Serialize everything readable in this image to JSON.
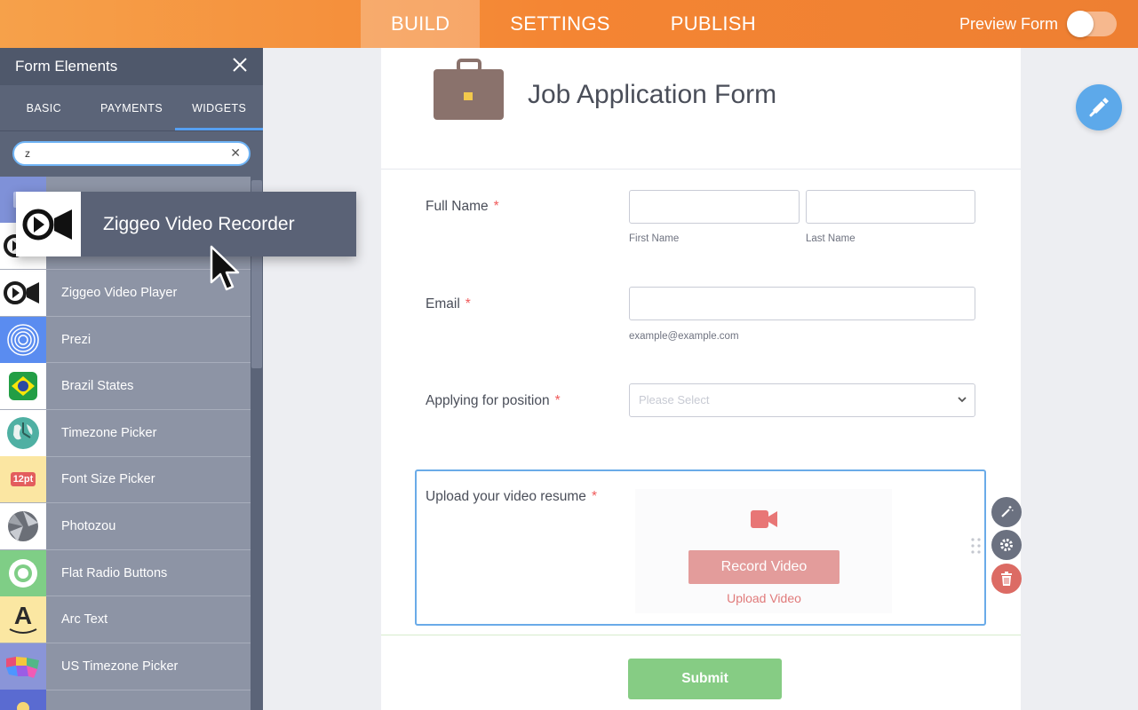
{
  "topbar": {
    "tabs": [
      {
        "label": "BUILD",
        "active": true
      },
      {
        "label": "SETTINGS",
        "active": false
      },
      {
        "label": "PUBLISH",
        "active": false
      }
    ],
    "preview_label": "Preview Form",
    "preview_on": false
  },
  "sidebar": {
    "title": "Form Elements",
    "tabs": [
      {
        "label": "BASIC",
        "active": false
      },
      {
        "label": "PAYMENTS",
        "active": false
      },
      {
        "label": "WIDGETS",
        "active": true
      }
    ],
    "search_value": "z",
    "items": [
      {
        "label": "",
        "icon": "widget-icon"
      },
      {
        "label": "",
        "icon": "ziggeo-recorder-icon"
      },
      {
        "label": "Ziggeo Video Player",
        "icon": "ziggeo-player-icon"
      },
      {
        "label": "Prezi",
        "icon": "prezi-icon"
      },
      {
        "label": "Brazil States",
        "icon": "brazil-flag-icon"
      },
      {
        "label": "Timezone Picker",
        "icon": "globe-icon"
      },
      {
        "label": "Font Size Picker",
        "icon": "font-size-icon",
        "icon_text": "12pt"
      },
      {
        "label": "Photozou",
        "icon": "photozou-icon"
      },
      {
        "label": "Flat Radio Buttons",
        "icon": "radio-button-icon"
      },
      {
        "label": "Arc Text",
        "icon": "arc-text-icon",
        "icon_text": "A"
      },
      {
        "label": "US Timezone Picker",
        "icon": "us-map-icon"
      },
      {
        "label": "",
        "icon": "widget-icon"
      }
    ]
  },
  "drag_ghost": {
    "label": "Ziggeo Video Recorder",
    "icon": "video-camera-icon"
  },
  "form": {
    "title": "Job Application Form",
    "full_name": {
      "label": "Full Name",
      "required": "*",
      "first_sub": "First Name",
      "last_sub": "Last Name"
    },
    "email": {
      "label": "Email",
      "required": "*",
      "sub": "example@example.com"
    },
    "position": {
      "label": "Applying for position",
      "required": "*",
      "placeholder": "Please Select"
    },
    "video": {
      "label": "Upload your video resume",
      "required": "*",
      "record_label": "Record Video",
      "upload_label": "Upload Video"
    },
    "submit_label": "Submit"
  },
  "colors": {
    "accent_orange": "#f48533",
    "sidebar_bg": "#5b6478",
    "selection_blue": "#6aabe8",
    "submit_green": "#86cc84",
    "record_red": "#e39c9b",
    "delete_red": "#dc6b64"
  }
}
